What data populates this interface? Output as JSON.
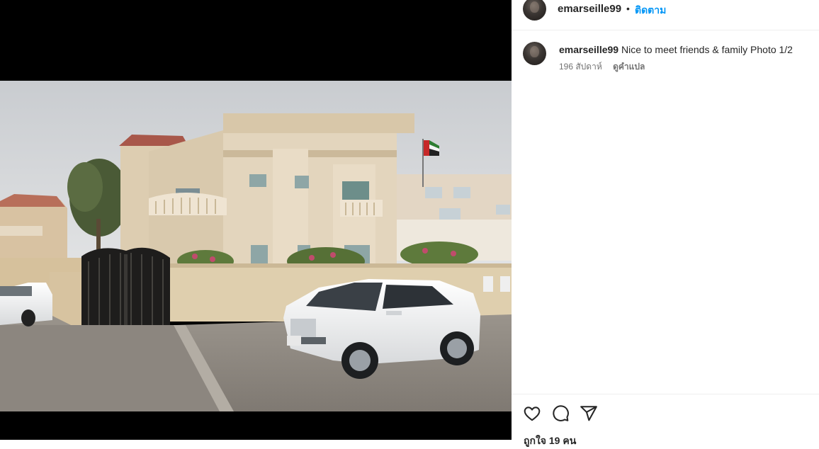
{
  "post": {
    "username": "emarseille99",
    "separator": "•",
    "follow_label": "ติดตาม"
  },
  "caption": {
    "username": "emarseille99",
    "text": "Nice to meet friends & family Photo 1/2",
    "age": "196 สัปดาห์",
    "translate_label": "ดูคำแปล"
  },
  "actions": {
    "like_icon": "heart-icon",
    "comment_icon": "comment-icon",
    "share_icon": "paper-plane-icon",
    "likes_text": "ถูกใจ 19 คน"
  },
  "colors": {
    "link_blue": "#0095f6",
    "text_primary": "#262626",
    "text_secondary": "#737373",
    "media_background": "#000000"
  }
}
